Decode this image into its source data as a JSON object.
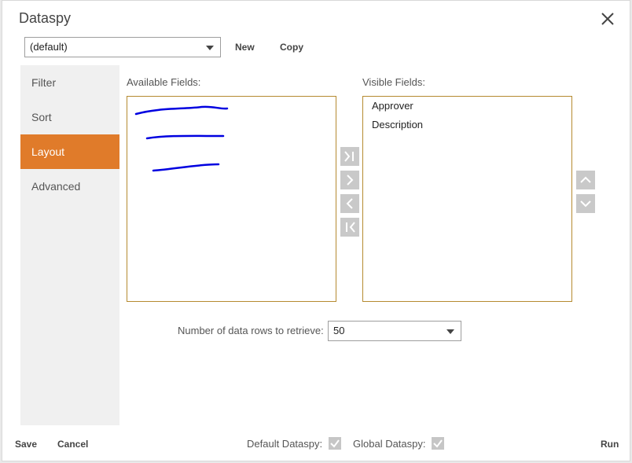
{
  "dialog": {
    "title": "Dataspy",
    "close_icon": "close-icon"
  },
  "toolbar": {
    "dataspy_value": "(default)",
    "new_label": "New",
    "copy_label": "Copy"
  },
  "sidebar": {
    "items": [
      {
        "label": "Filter"
      },
      {
        "label": "Sort"
      },
      {
        "label": "Layout",
        "active": true
      },
      {
        "label": "Advanced"
      }
    ],
    "active_color": "#e07b2a"
  },
  "layout": {
    "available_label": "Available Fields:",
    "visible_label": "Visible Fields:",
    "visible_fields": [
      "Approver",
      "Description"
    ],
    "move_buttons": [
      "move-all-right-icon",
      "move-right-icon",
      "move-left-icon",
      "move-all-left-icon"
    ],
    "order_buttons": [
      "move-up-icon",
      "move-down-icon"
    ],
    "rows_label": "Number of data rows to retrieve:",
    "rows_value": "50"
  },
  "footer": {
    "save_label": "Save",
    "cancel_label": "Cancel",
    "default_dataspy_label": "Default Dataspy:",
    "global_dataspy_label": "Global Dataspy:",
    "run_label": "Run",
    "default_checked": true,
    "global_checked": true
  }
}
